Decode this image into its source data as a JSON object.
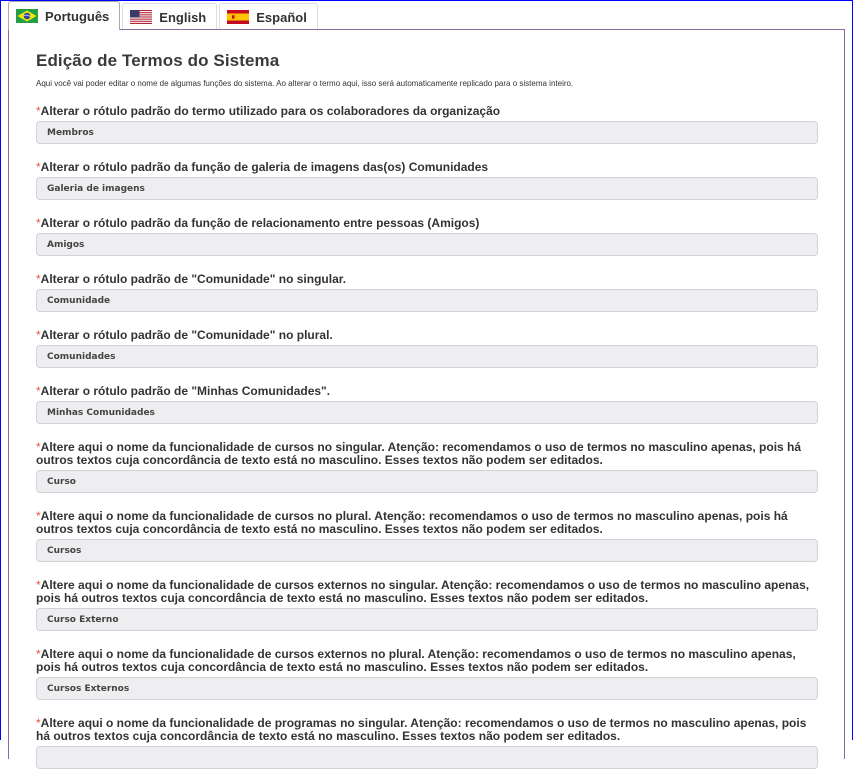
{
  "tabs": [
    {
      "label": "Português",
      "flag": "brazil-flag-icon",
      "active": true
    },
    {
      "label": "English",
      "flag": "usa-flag-icon",
      "active": false
    },
    {
      "label": "Español",
      "flag": "spain-flag-icon",
      "active": false
    }
  ],
  "page": {
    "title": "Edição de Termos do Sistema",
    "intro": "Aqui você vai poder editar o nome de algumas funções do sistema. Ao alterar o termo aqui, isso será automaticamente replicado para o sistema inteiro.",
    "required_mark": "*"
  },
  "fields": [
    {
      "label": "Alterar o rótulo padrão do termo utilizado para os colaboradores da organização",
      "value": "Membros"
    },
    {
      "label": "Alterar o rótulo padrão da função de galeria de imagens das(os) Comunidades",
      "value": "Galeria de imagens"
    },
    {
      "label": "Alterar o rótulo padrão da função de relacionamento entre pessoas (Amigos)",
      "value": "Amigos"
    },
    {
      "label": "Alterar o rótulo padrão de \"Comunidade\" no singular.",
      "value": "Comunidade"
    },
    {
      "label": "Alterar o rótulo padrão de \"Comunidade\" no plural.",
      "value": "Comunidades"
    },
    {
      "label": "Alterar o rótulo padrão de \"Minhas Comunidades\".",
      "value": "Minhas Comunidades"
    },
    {
      "label": "Altere aqui o nome da funcionalidade de cursos no singular. Atenção: recomendamos o uso de termos no masculino apenas, pois há outros textos cuja concordância de texto está no masculino. Esses textos não podem ser editados.",
      "value": "Curso"
    },
    {
      "label": "Altere aqui o nome da funcionalidade de cursos no plural. Atenção: recomendamos o uso de termos no masculino apenas, pois há outros textos cuja concordância de texto está no masculino. Esses textos não podem ser editados.",
      "value": "Cursos"
    },
    {
      "label": "Altere aqui o nome da funcionalidade de cursos externos no singular. Atenção: recomendamos o uso de termos no masculino apenas, pois há outros textos cuja concordância de texto está no masculino. Esses textos não podem ser editados.",
      "value": "Curso Externo"
    },
    {
      "label": "Altere aqui o nome da funcionalidade de cursos externos no plural. Atenção: recomendamos o uso de termos no masculino apenas, pois há outros textos cuja concordância de texto está no masculino. Esses textos não podem ser editados.",
      "value": "Cursos Externos"
    },
    {
      "label": "Altere aqui o nome da funcionalidade de programas no singular. Atenção: recomendamos o uso de termos no masculino apenas, pois há outros textos cuja concordância de texto está no masculino. Esses textos não podem ser editados.",
      "value": ""
    }
  ],
  "colors": {
    "required": "#e4572e",
    "panel_border": "#8a6d9c",
    "frame": "#0000ff",
    "input_bg": "#eeeef0"
  }
}
